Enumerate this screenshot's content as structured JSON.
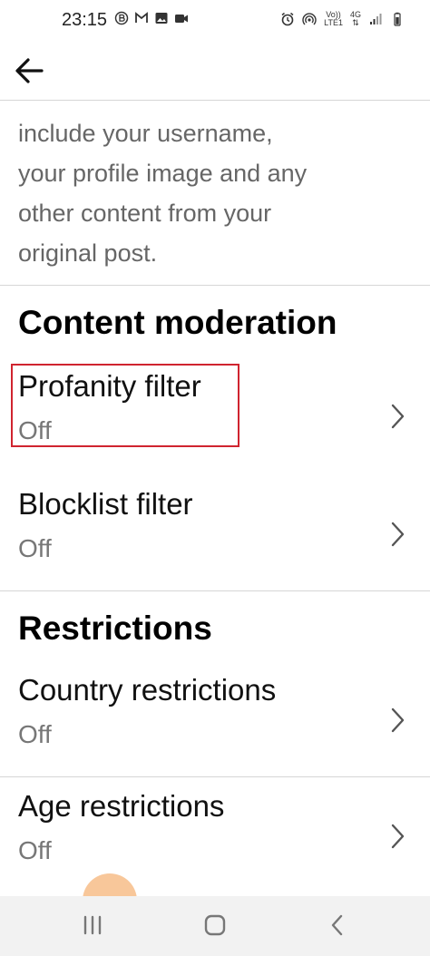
{
  "status_bar": {
    "time": "23:15",
    "network_top": "Vo))",
    "network_bottom": "LTE1",
    "network_gen": "4G"
  },
  "icons": {
    "back": "arrow-left-icon",
    "chevron": "chevron-right-icon"
  },
  "colors": {
    "highlight": "#d0242f",
    "secondary_text": "#777777",
    "divider": "#d6d6d6"
  },
  "description": {
    "text": "include your username,\nyour profile image and any\nother content from your\noriginal post."
  },
  "content_moderation": {
    "title": "Content moderation",
    "items": [
      {
        "label": "Profanity filter",
        "value": "Off"
      },
      {
        "label": "Blocklist filter",
        "value": "Off"
      }
    ]
  },
  "restrictions": {
    "title": "Restrictions",
    "items": [
      {
        "label": "Country restrictions",
        "value": "Off"
      },
      {
        "label": "Age restrictions",
        "value": "Off"
      }
    ]
  }
}
